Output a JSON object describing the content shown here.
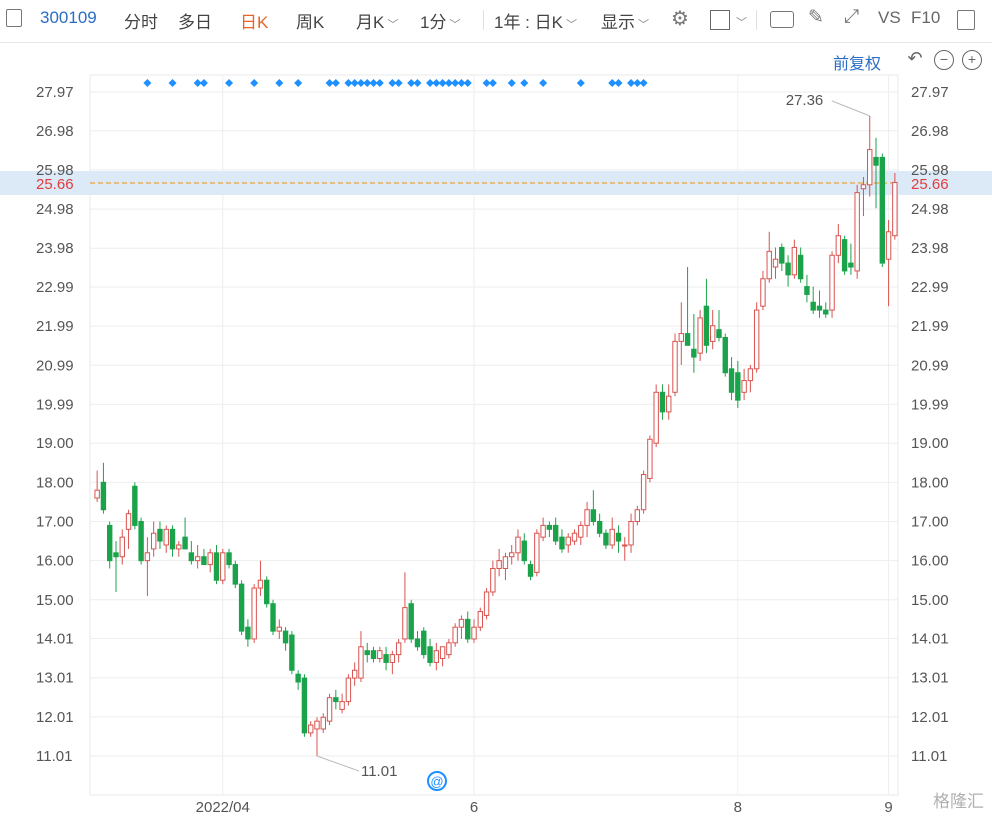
{
  "toolbar": {
    "stock_code": "300109",
    "tabs": [
      "分时",
      "多日",
      "日K",
      "周K",
      "月K",
      "1分"
    ],
    "active_tab": "日K",
    "range_select": "1年 : 日K",
    "display_label": "显示",
    "vs_label": "VS",
    "f10_label": "F10"
  },
  "controls": {
    "fuquan_label": "前复权"
  },
  "current_price": {
    "label": "25.66",
    "value": 25.66
  },
  "annotations": {
    "high_label": "27.36",
    "low_label": "11.01",
    "event_marker": "@"
  },
  "watermark": "格隆汇",
  "colors": {
    "up": "#d9534f",
    "down": "#1aa34a",
    "accent": "#2a6dc6",
    "active_tab": "#e8652a",
    "price_line": "#f0a040",
    "marker": "#1e90ff"
  },
  "chart_data": {
    "type": "candlestick",
    "yticks": [
      11.01,
      12.01,
      13.01,
      14.01,
      15.0,
      16.0,
      17.0,
      18.0,
      19.0,
      19.99,
      20.99,
      21.99,
      22.99,
      23.98,
      24.98,
      25.98,
      26.98,
      27.97
    ],
    "ylim": [
      10.5,
      28.5
    ],
    "xticks": [
      {
        "label": "2022/04",
        "index": 20
      },
      {
        "label": "6",
        "index": 60
      },
      {
        "label": "8",
        "index": 102
      },
      {
        "label": "9",
        "index": 126
      }
    ],
    "candles": [
      {
        "o": 17.6,
        "h": 18.3,
        "l": 17.5,
        "c": 17.8
      },
      {
        "o": 18.0,
        "h": 18.5,
        "l": 17.2,
        "c": 17.3
      },
      {
        "o": 16.9,
        "h": 17.0,
        "l": 15.8,
        "c": 16.0
      },
      {
        "o": 16.2,
        "h": 16.5,
        "l": 15.2,
        "c": 16.1
      },
      {
        "o": 16.1,
        "h": 16.8,
        "l": 15.9,
        "c": 16.6
      },
      {
        "o": 16.8,
        "h": 17.3,
        "l": 16.3,
        "c": 17.2
      },
      {
        "o": 17.9,
        "h": 18.0,
        "l": 16.8,
        "c": 16.9
      },
      {
        "o": 17.0,
        "h": 17.1,
        "l": 15.9,
        "c": 16.0
      },
      {
        "o": 16.0,
        "h": 16.6,
        "l": 15.1,
        "c": 16.2
      },
      {
        "o": 16.3,
        "h": 17.0,
        "l": 16.1,
        "c": 16.7
      },
      {
        "o": 16.8,
        "h": 17.0,
        "l": 16.3,
        "c": 16.5
      },
      {
        "o": 16.4,
        "h": 16.9,
        "l": 16.2,
        "c": 16.8
      },
      {
        "o": 16.8,
        "h": 16.9,
        "l": 16.1,
        "c": 16.3
      },
      {
        "o": 16.3,
        "h": 16.5,
        "l": 16.1,
        "c": 16.4
      },
      {
        "o": 16.6,
        "h": 17.1,
        "l": 16.3,
        "c": 16.3
      },
      {
        "o": 16.2,
        "h": 16.5,
        "l": 15.9,
        "c": 16.0
      },
      {
        "o": 16.0,
        "h": 16.4,
        "l": 15.8,
        "c": 16.1
      },
      {
        "o": 16.1,
        "h": 16.3,
        "l": 15.9,
        "c": 15.9
      },
      {
        "o": 15.9,
        "h": 16.3,
        "l": 15.7,
        "c": 16.2
      },
      {
        "o": 16.2,
        "h": 16.4,
        "l": 15.4,
        "c": 15.5
      },
      {
        "o": 15.5,
        "h": 16.3,
        "l": 15.4,
        "c": 16.2
      },
      {
        "o": 16.2,
        "h": 16.3,
        "l": 15.8,
        "c": 15.9
      },
      {
        "o": 15.9,
        "h": 16.0,
        "l": 15.3,
        "c": 15.4
      },
      {
        "o": 15.4,
        "h": 15.5,
        "l": 14.1,
        "c": 14.2
      },
      {
        "o": 14.3,
        "h": 14.5,
        "l": 13.8,
        "c": 14.0
      },
      {
        "o": 14.0,
        "h": 15.4,
        "l": 13.9,
        "c": 15.3
      },
      {
        "o": 15.3,
        "h": 16.0,
        "l": 15.1,
        "c": 15.5
      },
      {
        "o": 15.5,
        "h": 15.6,
        "l": 14.8,
        "c": 14.9
      },
      {
        "o": 14.9,
        "h": 15.0,
        "l": 14.1,
        "c": 14.2
      },
      {
        "o": 14.2,
        "h": 14.5,
        "l": 14.0,
        "c": 14.3
      },
      {
        "o": 14.2,
        "h": 14.3,
        "l": 13.7,
        "c": 13.9
      },
      {
        "o": 14.1,
        "h": 14.2,
        "l": 13.1,
        "c": 13.2
      },
      {
        "o": 13.1,
        "h": 13.2,
        "l": 12.7,
        "c": 12.9
      },
      {
        "o": 13.0,
        "h": 13.1,
        "l": 11.5,
        "c": 11.6
      },
      {
        "o": 11.6,
        "h": 11.9,
        "l": 11.5,
        "c": 11.8
      },
      {
        "o": 11.7,
        "h": 12.0,
        "l": 11.01,
        "c": 11.9
      },
      {
        "o": 11.7,
        "h": 12.1,
        "l": 11.6,
        "c": 12.0
      },
      {
        "o": 11.9,
        "h": 12.6,
        "l": 11.8,
        "c": 12.5
      },
      {
        "o": 12.5,
        "h": 12.7,
        "l": 12.2,
        "c": 12.4
      },
      {
        "o": 12.2,
        "h": 12.6,
        "l": 12.1,
        "c": 12.4
      },
      {
        "o": 12.4,
        "h": 13.1,
        "l": 12.3,
        "c": 13.0
      },
      {
        "o": 13.0,
        "h": 13.4,
        "l": 12.8,
        "c": 13.2
      },
      {
        "o": 13.0,
        "h": 14.2,
        "l": 12.9,
        "c": 13.8
      },
      {
        "o": 13.7,
        "h": 13.9,
        "l": 13.4,
        "c": 13.6
      },
      {
        "o": 13.7,
        "h": 13.8,
        "l": 13.4,
        "c": 13.5
      },
      {
        "o": 13.5,
        "h": 13.8,
        "l": 13.4,
        "c": 13.7
      },
      {
        "o": 13.6,
        "h": 13.8,
        "l": 13.2,
        "c": 13.4
      },
      {
        "o": 13.4,
        "h": 13.7,
        "l": 13.1,
        "c": 13.6
      },
      {
        "o": 13.6,
        "h": 14.0,
        "l": 13.4,
        "c": 13.9
      },
      {
        "o": 14.0,
        "h": 15.7,
        "l": 13.9,
        "c": 14.8
      },
      {
        "o": 14.9,
        "h": 15.0,
        "l": 13.9,
        "c": 14.0
      },
      {
        "o": 14.0,
        "h": 14.2,
        "l": 13.7,
        "c": 13.8
      },
      {
        "o": 14.2,
        "h": 14.3,
        "l": 13.5,
        "c": 13.6
      },
      {
        "o": 13.8,
        "h": 14.0,
        "l": 13.3,
        "c": 13.4
      },
      {
        "o": 13.4,
        "h": 13.9,
        "l": 13.2,
        "c": 13.7
      },
      {
        "o": 13.5,
        "h": 13.8,
        "l": 13.3,
        "c": 13.8
      },
      {
        "o": 13.6,
        "h": 14.0,
        "l": 13.5,
        "c": 13.9
      },
      {
        "o": 13.9,
        "h": 14.4,
        "l": 13.8,
        "c": 14.3
      },
      {
        "o": 14.3,
        "h": 14.6,
        "l": 14.0,
        "c": 14.5
      },
      {
        "o": 14.5,
        "h": 14.7,
        "l": 13.9,
        "c": 14.0
      },
      {
        "o": 14.0,
        "h": 14.5,
        "l": 13.9,
        "c": 14.3
      },
      {
        "o": 14.3,
        "h": 14.8,
        "l": 14.2,
        "c": 14.7
      },
      {
        "o": 14.6,
        "h": 15.3,
        "l": 14.5,
        "c": 15.2
      },
      {
        "o": 15.2,
        "h": 16.0,
        "l": 15.1,
        "c": 15.8
      },
      {
        "o": 15.8,
        "h": 16.3,
        "l": 15.6,
        "c": 16.0
      },
      {
        "o": 15.8,
        "h": 16.2,
        "l": 15.5,
        "c": 16.1
      },
      {
        "o": 16.1,
        "h": 16.4,
        "l": 15.9,
        "c": 16.2
      },
      {
        "o": 16.2,
        "h": 16.8,
        "l": 16.0,
        "c": 16.6
      },
      {
        "o": 16.5,
        "h": 16.7,
        "l": 15.9,
        "c": 16.0
      },
      {
        "o": 15.9,
        "h": 16.0,
        "l": 15.5,
        "c": 15.6
      },
      {
        "o": 15.7,
        "h": 16.8,
        "l": 15.6,
        "c": 16.7
      },
      {
        "o": 16.6,
        "h": 17.1,
        "l": 16.5,
        "c": 16.9
      },
      {
        "o": 16.9,
        "h": 17.0,
        "l": 16.6,
        "c": 16.8
      },
      {
        "o": 16.9,
        "h": 17.1,
        "l": 16.4,
        "c": 16.5
      },
      {
        "o": 16.6,
        "h": 16.8,
        "l": 16.2,
        "c": 16.3
      },
      {
        "o": 16.4,
        "h": 16.7,
        "l": 16.2,
        "c": 16.6
      },
      {
        "o": 16.5,
        "h": 16.8,
        "l": 16.4,
        "c": 16.7
      },
      {
        "o": 16.6,
        "h": 17.0,
        "l": 16.4,
        "c": 16.9
      },
      {
        "o": 16.9,
        "h": 17.5,
        "l": 16.6,
        "c": 17.3
      },
      {
        "o": 17.3,
        "h": 17.8,
        "l": 16.9,
        "c": 17.0
      },
      {
        "o": 17.0,
        "h": 17.2,
        "l": 16.6,
        "c": 16.7
      },
      {
        "o": 16.7,
        "h": 16.8,
        "l": 16.3,
        "c": 16.4
      },
      {
        "o": 16.4,
        "h": 17.1,
        "l": 16.3,
        "c": 16.8
      },
      {
        "o": 16.7,
        "h": 16.9,
        "l": 16.2,
        "c": 16.5
      },
      {
        "o": 16.4,
        "h": 16.6,
        "l": 16.0,
        "c": 16.4
      },
      {
        "o": 16.4,
        "h": 17.2,
        "l": 16.2,
        "c": 17.0
      },
      {
        "o": 17.0,
        "h": 17.4,
        "l": 16.9,
        "c": 17.3
      },
      {
        "o": 17.3,
        "h": 18.3,
        "l": 17.2,
        "c": 18.2
      },
      {
        "o": 18.1,
        "h": 19.2,
        "l": 18.0,
        "c": 19.1
      },
      {
        "o": 19.0,
        "h": 20.5,
        "l": 18.9,
        "c": 20.3
      },
      {
        "o": 20.3,
        "h": 20.5,
        "l": 19.6,
        "c": 19.8
      },
      {
        "o": 19.8,
        "h": 20.5,
        "l": 19.6,
        "c": 20.2
      },
      {
        "o": 20.3,
        "h": 21.8,
        "l": 20.2,
        "c": 21.6
      },
      {
        "o": 21.6,
        "h": 22.6,
        "l": 21.0,
        "c": 21.8
      },
      {
        "o": 21.8,
        "h": 23.5,
        "l": 21.7,
        "c": 21.5
      },
      {
        "o": 21.4,
        "h": 22.3,
        "l": 20.8,
        "c": 21.2
      },
      {
        "o": 21.3,
        "h": 22.4,
        "l": 21.1,
        "c": 22.2
      },
      {
        "o": 22.5,
        "h": 23.2,
        "l": 21.3,
        "c": 21.5
      },
      {
        "o": 21.6,
        "h": 22.4,
        "l": 21.4,
        "c": 22.0
      },
      {
        "o": 21.9,
        "h": 22.4,
        "l": 21.6,
        "c": 21.7
      },
      {
        "o": 21.7,
        "h": 21.8,
        "l": 20.7,
        "c": 20.8
      },
      {
        "o": 20.9,
        "h": 21.2,
        "l": 20.1,
        "c": 20.3
      },
      {
        "o": 20.8,
        "h": 21.1,
        "l": 19.9,
        "c": 20.1
      },
      {
        "o": 20.3,
        "h": 20.9,
        "l": 20.1,
        "c": 20.6
      },
      {
        "o": 20.6,
        "h": 21.0,
        "l": 20.3,
        "c": 20.9
      },
      {
        "o": 20.9,
        "h": 22.6,
        "l": 20.8,
        "c": 22.4
      },
      {
        "o": 22.5,
        "h": 23.4,
        "l": 22.4,
        "c": 23.2
      },
      {
        "o": 23.2,
        "h": 24.4,
        "l": 23.1,
        "c": 23.9
      },
      {
        "o": 23.5,
        "h": 24.0,
        "l": 23.2,
        "c": 23.7
      },
      {
        "o": 24.0,
        "h": 24.1,
        "l": 23.4,
        "c": 23.6
      },
      {
        "o": 23.6,
        "h": 23.8,
        "l": 23.0,
        "c": 23.3
      },
      {
        "o": 23.3,
        "h": 24.2,
        "l": 23.2,
        "c": 24.0
      },
      {
        "o": 23.8,
        "h": 24.0,
        "l": 23.1,
        "c": 23.2
      },
      {
        "o": 23.0,
        "h": 23.3,
        "l": 22.6,
        "c": 22.8
      },
      {
        "o": 22.6,
        "h": 23.0,
        "l": 22.3,
        "c": 22.4
      },
      {
        "o": 22.5,
        "h": 22.9,
        "l": 22.2,
        "c": 22.4
      },
      {
        "o": 22.4,
        "h": 22.6,
        "l": 22.2,
        "c": 22.3
      },
      {
        "o": 22.4,
        "h": 23.9,
        "l": 22.2,
        "c": 23.8
      },
      {
        "o": 23.8,
        "h": 24.6,
        "l": 23.6,
        "c": 24.3
      },
      {
        "o": 24.2,
        "h": 24.3,
        "l": 23.3,
        "c": 23.4
      },
      {
        "o": 23.6,
        "h": 24.1,
        "l": 23.3,
        "c": 23.5
      },
      {
        "o": 23.4,
        "h": 25.6,
        "l": 23.2,
        "c": 25.4
      },
      {
        "o": 25.5,
        "h": 25.8,
        "l": 24.8,
        "c": 25.6
      },
      {
        "o": 25.6,
        "h": 27.36,
        "l": 25.3,
        "c": 26.5
      },
      {
        "o": 26.3,
        "h": 26.8,
        "l": 25.0,
        "c": 26.1
      },
      {
        "o": 26.3,
        "h": 26.4,
        "l": 23.5,
        "c": 23.6
      },
      {
        "o": 23.7,
        "h": 24.7,
        "l": 22.5,
        "c": 24.4
      },
      {
        "o": 24.3,
        "h": 25.9,
        "l": 24.2,
        "c": 25.66
      }
    ],
    "markers": [
      8,
      12,
      16,
      17,
      21,
      25,
      29,
      32,
      37,
      38,
      40,
      41,
      42,
      43,
      44,
      45,
      47,
      48,
      50,
      51,
      53,
      54,
      55,
      56,
      57,
      58,
      59,
      62,
      63,
      66,
      68,
      71,
      77,
      82,
      83,
      85,
      86,
      87
    ]
  }
}
